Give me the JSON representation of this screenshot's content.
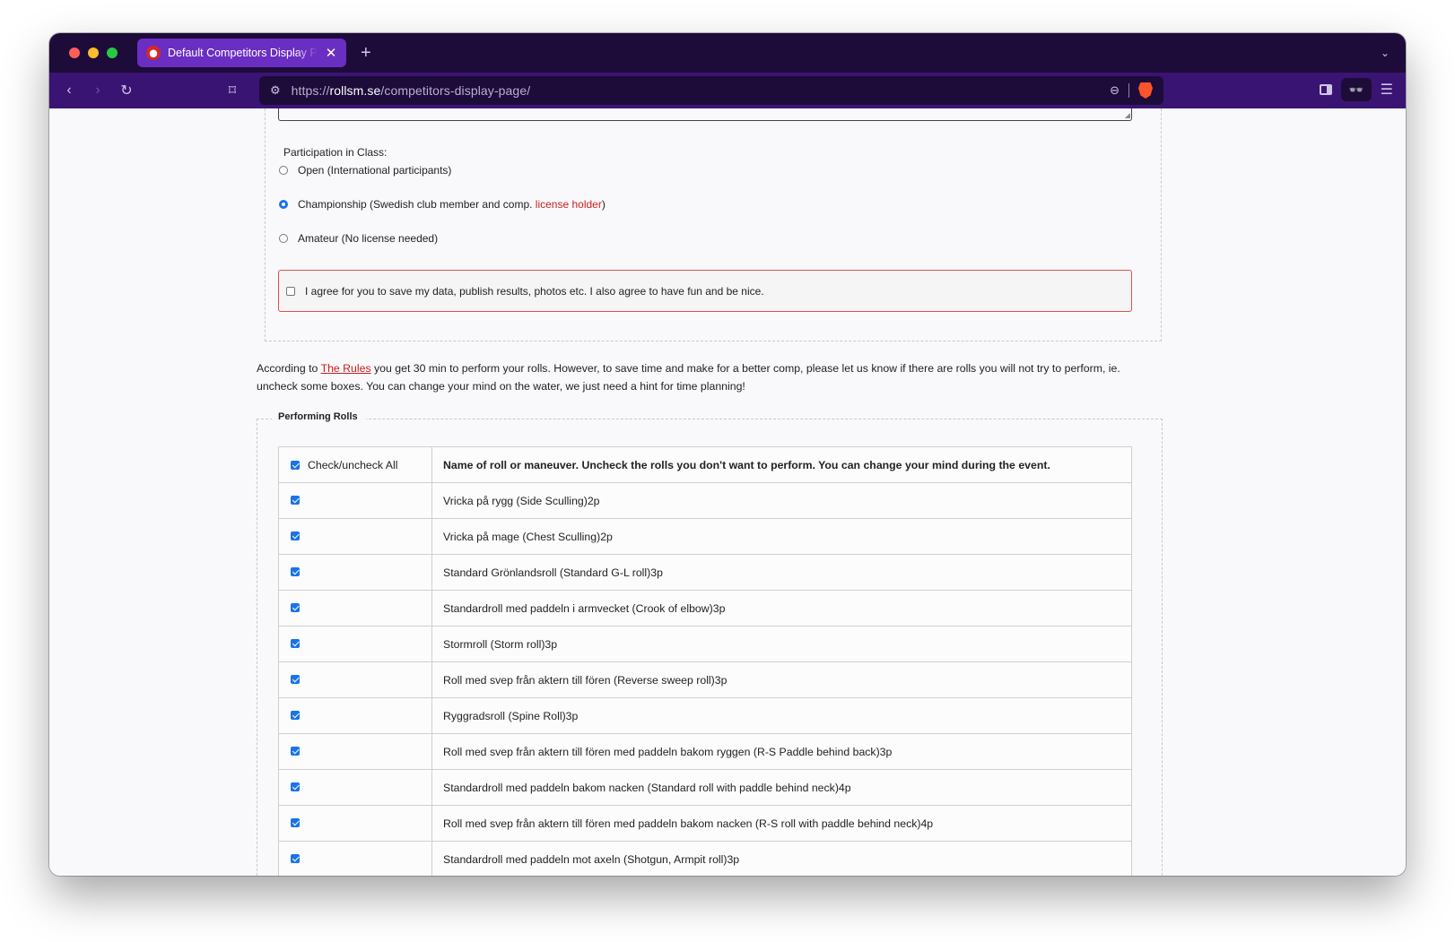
{
  "browser": {
    "tab_title": "Default Competitors Display Page",
    "url_prefix": "https://",
    "url_domain": "rollsm.se",
    "url_path": "/competitors-display-page/",
    "glasses_glyph": "👓"
  },
  "form": {
    "participation_label": "Participation in Class:",
    "classes": [
      {
        "label": "Open (International participants)",
        "selected": false
      },
      {
        "label_before": "Championship (Swedish club member and comp. ",
        "link": "license holder",
        "label_after": ")",
        "selected": true
      },
      {
        "label": "Amateur (No license needed)",
        "selected": false
      }
    ],
    "agree_text": "I agree for you to save my data, publish results, photos etc. I also agree to have fun and be nice.",
    "agree_checked": false
  },
  "info": {
    "before": "According to ",
    "link": "The Rules",
    "after": " you get 30 min to perform your rolls. However, to save time and make for a better comp, please let us know if there are rolls you will not try to perform, ie. uncheck some boxes. You can change your mind on the water, we just need a hint for time planning!"
  },
  "rolls": {
    "legend": "Performing Rolls",
    "check_all_label": "Check/uncheck All",
    "header": "Name of roll or maneuver. Uncheck the rolls you don't want to perform. You can change your mind during the event.",
    "items": [
      {
        "name": "Vricka på rygg (Side Sculling)2p",
        "checked": true
      },
      {
        "name": "Vricka på mage (Chest Sculling)2p",
        "checked": true
      },
      {
        "name": "Standard Grönlandsroll (Standard G-L roll)3p",
        "checked": true
      },
      {
        "name": "Standardroll med paddeln i armvecket (Crook of elbow)3p",
        "checked": true
      },
      {
        "name": "Stormroll (Storm roll)3p",
        "checked": true
      },
      {
        "name": "Roll med svep från aktern till fören (Reverse sweep roll)3p",
        "checked": true
      },
      {
        "name": "Ryggradsroll (Spine Roll)3p",
        "checked": true
      },
      {
        "name": "Roll med svep från aktern till fören med paddeln bakom ryggen (R-S Paddle behind back)3p",
        "checked": true
      },
      {
        "name": "Standardroll med paddeln bakom nacken (Standard roll with paddle behind neck)4p",
        "checked": true
      },
      {
        "name": "Roll med svep från aktern till fören med paddeln bakom nacken (R-S roll with paddle behind neck)4p",
        "checked": true
      },
      {
        "name": "Standardroll med paddeln mot axeln (Shotgun, Armpit roll)3p",
        "checked": true
      }
    ]
  },
  "colors": {
    "tabbar": "#1d0b3a",
    "navbar": "#3a1473",
    "active_tab": "#6a2ec2",
    "link_red": "#c81e1e",
    "checkbox_blue": "#1a73e8"
  }
}
